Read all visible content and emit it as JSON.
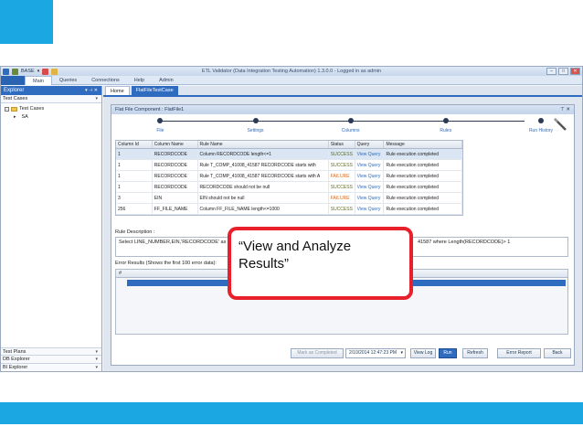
{
  "app": {
    "db_selector": "BASE",
    "title": "ETL Validator (Data Integration Testing Automation) 1.3.0.0 - Logged in as admin",
    "menu": [
      "Main",
      "Queries",
      "Connections",
      "Help",
      "Admin"
    ],
    "active_menu": "Main"
  },
  "explorer": {
    "title": "Explorer",
    "pin": "▾ ⊣ ✕",
    "test_cases_label": "Test Cases",
    "tree": [
      {
        "label": "Test Cases",
        "expander": "−"
      },
      {
        "label": "SA",
        "expander": "▸"
      }
    ],
    "bottom_sections": [
      "Test Plans",
      "DB Explorer",
      "BI Explorer"
    ]
  },
  "tabs": {
    "home": "Home",
    "active": "FlatFileTestCase"
  },
  "panel": {
    "title": "Flat File Component : FlatFile1",
    "controls": "⊤ ✕",
    "wizard_steps": [
      "File",
      "Settings",
      "Columns",
      "Rules",
      "Run History"
    ]
  },
  "grid": {
    "headers": [
      "Column Id",
      "Column Name",
      "Rule Name",
      "Status",
      "Query",
      "Message"
    ],
    "rows": [
      {
        "id": "1",
        "column": "RECORDCODE",
        "rule": "Column RECORDCODE length<=1",
        "status": "SUCCESS",
        "query": "View Query",
        "message": "Rule execution completed"
      },
      {
        "id": "1",
        "column": "RECORDCODE",
        "rule": "Rule T_COMP_41008_41587 RECORDCODE starts with",
        "status": "SUCCESS",
        "query": "View Query",
        "message": "Rule execution completed"
      },
      {
        "id": "1",
        "column": "RECORDCODE",
        "rule": "Rule T_COMP_41008_41587 RECORDCODE starts with A",
        "status": "FAILURE",
        "query": "View Query",
        "message": "Rule execution completed"
      },
      {
        "id": "1",
        "column": "RECORDCODE",
        "rule": "RECORDCODE should not be null",
        "status": "SUCCESS",
        "query": "View Query",
        "message": "Rule execution completed"
      },
      {
        "id": "3",
        "column": "EIN",
        "rule": "EIN should not be null",
        "status": "FAILURE",
        "query": "View Query",
        "message": "Rule execution completed"
      },
      {
        "id": "256",
        "column": "FF_FILE_NAME",
        "rule": "Column FF_FILE_NAME length<=1000",
        "status": "SUCCESS",
        "query": "View Query",
        "message": "Rule execution completed"
      }
    ]
  },
  "rule_description": {
    "label": "Rule Description :",
    "text_start": "Select LINE_NUMBER,EIN,'RECORDCODE' as ER",
    "text_end": "41587 where Length(RECORDCODE)> 1"
  },
  "error_results": {
    "label": "Error Results (Shows the first 100 error data):",
    "col": "#"
  },
  "footer": {
    "mark_completed": "Mark as Completed",
    "date": "2/10/2014 12:47:23 PM",
    "date_chevron": "▾",
    "view_log": "View Log",
    "run": "Run",
    "refresh": "Refresh",
    "error_report": "Error Report",
    "back": "Back"
  },
  "callout": {
    "text": "“View and Analyze Results”"
  },
  "colors": {
    "brand_blue": "#1ba7e2",
    "app_blue": "#2f6cbf",
    "callout_red": "#e8202c",
    "failure": "#d2691e"
  }
}
